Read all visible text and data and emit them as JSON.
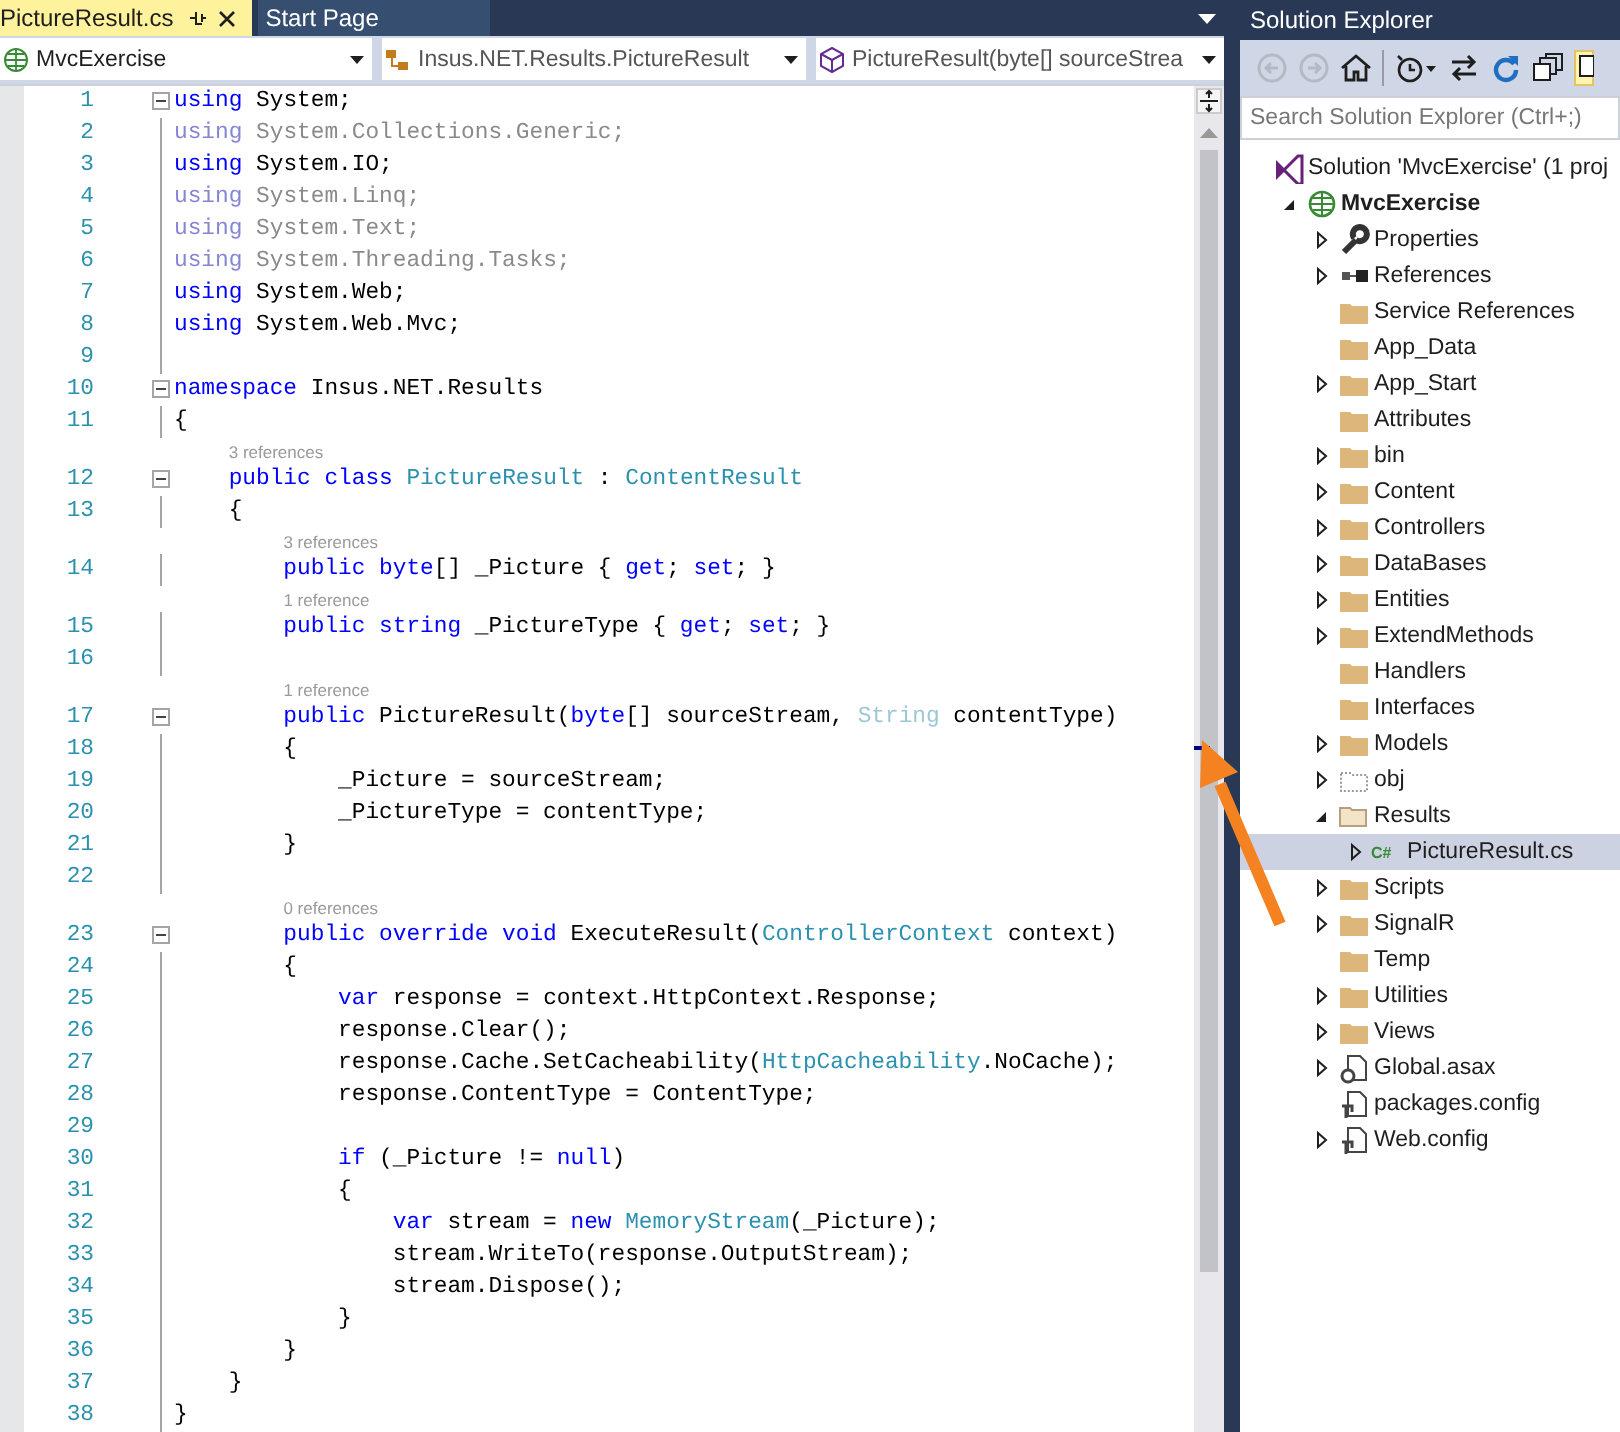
{
  "tabs": [
    {
      "label": "PictureResult.cs",
      "selected": true
    },
    {
      "label": "Start Page",
      "selected": false
    }
  ],
  "navigation_bar": [
    {
      "kind": "project",
      "text": "MvcExercise"
    },
    {
      "kind": "class",
      "text": "Insus.NET.Results.PictureResult"
    },
    {
      "kind": "member",
      "text": "PictureResult(byte[] sourceStrea"
    }
  ],
  "editor": {
    "lines": [
      {
        "number": "1",
        "fold": true,
        "tokens": [
          {
            "kind": "keyword",
            "text": "using"
          },
          {
            "kind": "text",
            "text": " System;"
          }
        ]
      },
      {
        "number": "2",
        "tokens": [
          {
            "kind": "unused-keyword",
            "text": "using"
          },
          {
            "kind": "unused-text",
            "text": " System.Collections.Generic;"
          }
        ]
      },
      {
        "number": "3",
        "tokens": [
          {
            "kind": "keyword",
            "text": "using"
          },
          {
            "kind": "text",
            "text": " System.IO;"
          }
        ]
      },
      {
        "number": "4",
        "tokens": [
          {
            "kind": "unused-keyword",
            "text": "using"
          },
          {
            "kind": "unused-text",
            "text": " System.Linq;"
          }
        ]
      },
      {
        "number": "5",
        "tokens": [
          {
            "kind": "unused-keyword",
            "text": "using"
          },
          {
            "kind": "unused-text",
            "text": " System.Text;"
          }
        ]
      },
      {
        "number": "6",
        "tokens": [
          {
            "kind": "unused-keyword",
            "text": "using"
          },
          {
            "kind": "unused-text",
            "text": " System.Threading.Tasks;"
          }
        ]
      },
      {
        "number": "7",
        "tokens": [
          {
            "kind": "keyword",
            "text": "using"
          },
          {
            "kind": "text",
            "text": " System.Web;"
          }
        ]
      },
      {
        "number": "8",
        "tokens": [
          {
            "kind": "keyword",
            "text": "using"
          },
          {
            "kind": "text",
            "text": " System.Web.Mvc;"
          }
        ]
      },
      {
        "number": "9"
      },
      {
        "number": "10",
        "fold": true,
        "tokens": [
          {
            "kind": "keyword",
            "text": "namespace"
          },
          {
            "kind": "text",
            "text": " Insus.NET.Results"
          }
        ]
      },
      {
        "number": "11",
        "tokens": [
          {
            "kind": "text",
            "text": "{"
          }
        ]
      },
      {
        "number": "12",
        "fold": true,
        "lens": "3 references",
        "tokens": [
          {
            "kind": "keyword",
            "text": "    public class "
          },
          {
            "kind": "type",
            "text": "PictureResult"
          },
          {
            "kind": "text",
            "text": " : "
          },
          {
            "kind": "type",
            "text": "ContentResult"
          }
        ]
      },
      {
        "number": "13",
        "tokens": [
          {
            "kind": "text",
            "text": "    {"
          }
        ]
      },
      {
        "number": "14",
        "lens": "3 references",
        "tokens": [
          {
            "kind": "keyword",
            "text": "        public byte"
          },
          {
            "kind": "text",
            "text": "[] _Picture { "
          },
          {
            "kind": "keyword",
            "text": "get"
          },
          {
            "kind": "text",
            "text": "; "
          },
          {
            "kind": "keyword",
            "text": "set"
          },
          {
            "kind": "text",
            "text": "; }"
          }
        ]
      },
      {
        "number": "15",
        "lens": "1 reference",
        "tokens": [
          {
            "kind": "keyword",
            "text": "        public string"
          },
          {
            "kind": "text",
            "text": " _PictureType { "
          },
          {
            "kind": "keyword",
            "text": "get"
          },
          {
            "kind": "text",
            "text": "; "
          },
          {
            "kind": "keyword",
            "text": "set"
          },
          {
            "kind": "text",
            "text": "; }"
          }
        ]
      },
      {
        "number": "16"
      },
      {
        "number": "17",
        "fold": true,
        "lens": "1 reference",
        "tokens": [
          {
            "kind": "keyword",
            "text": "        public"
          },
          {
            "kind": "text",
            "text": " PictureResult("
          },
          {
            "kind": "keyword",
            "text": "byte"
          },
          {
            "kind": "text",
            "text": "[] sourceStream, "
          },
          {
            "kind": "faded-type",
            "text": "String"
          },
          {
            "kind": "text",
            "text": " contentType)"
          }
        ]
      },
      {
        "number": "18",
        "tokens": [
          {
            "kind": "text",
            "text": "        {"
          }
        ]
      },
      {
        "number": "19",
        "tokens": [
          {
            "kind": "text",
            "text": "            _Picture = sourceStream;"
          }
        ]
      },
      {
        "number": "20",
        "tokens": [
          {
            "kind": "text",
            "text": "            _PictureType = contentType;"
          }
        ]
      },
      {
        "number": "21",
        "tokens": [
          {
            "kind": "text",
            "text": "        }"
          }
        ]
      },
      {
        "number": "22"
      },
      {
        "number": "23",
        "fold": true,
        "lens": "0 references",
        "tokens": [
          {
            "kind": "keyword",
            "text": "        public override void"
          },
          {
            "kind": "text",
            "text": " ExecuteResult("
          },
          {
            "kind": "type",
            "text": "ControllerContext"
          },
          {
            "kind": "text",
            "text": " context)"
          }
        ]
      },
      {
        "number": "24",
        "tokens": [
          {
            "kind": "text",
            "text": "        {"
          }
        ]
      },
      {
        "number": "25",
        "tokens": [
          {
            "kind": "keyword",
            "text": "            var"
          },
          {
            "kind": "text",
            "text": " response = context.HttpContext.Response;"
          }
        ]
      },
      {
        "number": "26",
        "tokens": [
          {
            "kind": "text",
            "text": "            response.Clear();"
          }
        ]
      },
      {
        "number": "27",
        "tokens": [
          {
            "kind": "text",
            "text": "            response.Cache.SetCacheability("
          },
          {
            "kind": "type",
            "text": "HttpCacheability"
          },
          {
            "kind": "text",
            "text": ".NoCache);"
          }
        ]
      },
      {
        "number": "28",
        "tokens": [
          {
            "kind": "text",
            "text": "            response.ContentType = ContentType;"
          }
        ]
      },
      {
        "number": "29"
      },
      {
        "number": "30",
        "tokens": [
          {
            "kind": "keyword",
            "text": "            if"
          },
          {
            "kind": "text",
            "text": " (_Picture != "
          },
          {
            "kind": "keyword",
            "text": "null"
          },
          {
            "kind": "text",
            "text": ")"
          }
        ]
      },
      {
        "number": "31",
        "tokens": [
          {
            "kind": "text",
            "text": "            {"
          }
        ]
      },
      {
        "number": "32",
        "tokens": [
          {
            "kind": "keyword",
            "text": "                var"
          },
          {
            "kind": "text",
            "text": " stream = "
          },
          {
            "kind": "keyword",
            "text": "new "
          },
          {
            "kind": "type",
            "text": "MemoryStream"
          },
          {
            "kind": "text",
            "text": "(_Picture);"
          }
        ]
      },
      {
        "number": "33",
        "tokens": [
          {
            "kind": "text",
            "text": "                stream.WriteTo(response.OutputStream);"
          }
        ]
      },
      {
        "number": "34",
        "tokens": [
          {
            "kind": "text",
            "text": "                stream.Dispose();"
          }
        ]
      },
      {
        "number": "35",
        "tokens": [
          {
            "kind": "text",
            "text": "            }"
          }
        ]
      },
      {
        "number": "36",
        "tokens": [
          {
            "kind": "text",
            "text": "        }"
          }
        ]
      },
      {
        "number": "37",
        "tokens": [
          {
            "kind": "text",
            "text": "    }"
          }
        ]
      },
      {
        "number": "38",
        "tokens": [
          {
            "kind": "text",
            "text": "}"
          }
        ]
      }
    ]
  },
  "explorer": {
    "title": "Solution Explorer",
    "toolbar": [
      {
        "kind": "back",
        "disabled": true
      },
      {
        "kind": "forward",
        "disabled": true
      },
      {
        "kind": "home",
        "disabled": false
      },
      {
        "kind": "history",
        "disabled": false
      },
      {
        "kind": "sync",
        "disabled": false
      },
      {
        "kind": "refresh",
        "disabled": false
      },
      {
        "kind": "collapse",
        "disabled": false
      },
      {
        "kind": "show-all",
        "disabled": false
      }
    ],
    "search": {
      "placeholder": "Search Solution Explorer (Ctrl+;)"
    },
    "tree": [
      {
        "label": "Solution 'MvcExercise' (1 proj",
        "kind": "solution",
        "selected": false,
        "children": [
          {
            "label": "MvcExercise",
            "kind": "project",
            "expanded": true,
            "selected": false,
            "children": [
              {
                "label": "Properties",
                "kind": "properties",
                "expanded": false,
                "selected": false
              },
              {
                "label": "References",
                "kind": "references",
                "expanded": false,
                "selected": false
              },
              {
                "label": "Service References",
                "kind": "folder",
                "selected": false
              },
              {
                "label": "App_Data",
                "kind": "folder",
                "selected": false
              },
              {
                "label": "App_Start",
                "kind": "folder",
                "expanded": false,
                "selected": false
              },
              {
                "label": "Attributes",
                "kind": "folder",
                "selected": false
              },
              {
                "label": "bin",
                "kind": "folder",
                "expanded": false,
                "selected": false
              },
              {
                "label": "Content",
                "kind": "folder",
                "expanded": false,
                "selected": false
              },
              {
                "label": "Controllers",
                "kind": "folder",
                "expanded": false,
                "selected": false
              },
              {
                "label": "DataBases",
                "kind": "folder",
                "expanded": false,
                "selected": false
              },
              {
                "label": "Entities",
                "kind": "folder",
                "expanded": false,
                "selected": false
              },
              {
                "label": "ExtendMethods",
                "kind": "folder",
                "expanded": false,
                "selected": false
              },
              {
                "label": "Handlers",
                "kind": "folder",
                "selected": false
              },
              {
                "label": "Interfaces",
                "kind": "folder",
                "selected": false
              },
              {
                "label": "Models",
                "kind": "folder",
                "expanded": false,
                "selected": false
              },
              {
                "label": "obj",
                "kind": "excluded-folder",
                "expanded": false,
                "selected": false
              },
              {
                "label": "Results",
                "kind": "folder",
                "expanded": true,
                "selected": false,
                "children": [
                  {
                    "label": "PictureResult.cs",
                    "kind": "code-file",
                    "icon_text": "C#",
                    "expanded": false,
                    "selected": true
                  }
                ]
              },
              {
                "label": "Scripts",
                "kind": "folder",
                "expanded": false,
                "selected": false
              },
              {
                "label": "SignalR",
                "kind": "folder",
                "expanded": false,
                "selected": false
              },
              {
                "label": "Temp",
                "kind": "folder",
                "selected": false
              },
              {
                "label": "Utilities",
                "kind": "folder",
                "expanded": false,
                "selected": false
              },
              {
                "label": "Views",
                "kind": "folder",
                "expanded": false,
                "selected": false
              },
              {
                "label": "Global.asax",
                "kind": "global",
                "expanded": false,
                "selected": false
              },
              {
                "label": "packages.config",
                "kind": "config",
                "selected": false
              },
              {
                "label": "Web.config",
                "kind": "config",
                "expanded": false,
                "selected": false
              }
            ]
          }
        ]
      }
    ]
  },
  "annotations": [
    {
      "kind": "arrow"
    }
  ]
}
